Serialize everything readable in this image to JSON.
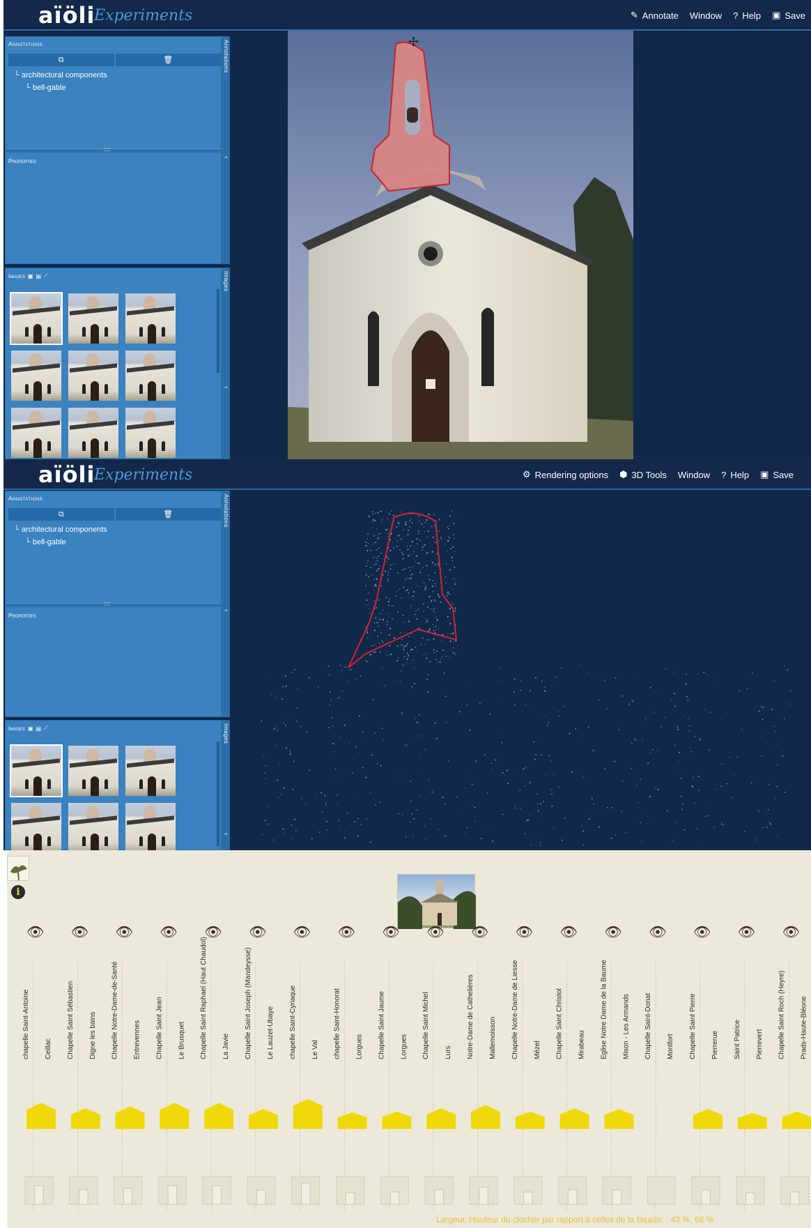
{
  "app_top": {
    "logo": "aïöli",
    "logo_sub": "Experiments",
    "menu": [
      {
        "icon": "pencil-icon",
        "glyph": "✎",
        "label": "Annotate"
      },
      {
        "icon": "",
        "glyph": "",
        "label": "Window"
      },
      {
        "icon": "help-icon",
        "glyph": "?",
        "label": "Help"
      },
      {
        "icon": "save-icon",
        "glyph": "▣",
        "label": "Save"
      }
    ],
    "annotations_title": "Annotations",
    "annotations_tab": "Annotations",
    "tree_parent": "architectural components",
    "tree_child": "bell-gable",
    "properties_title": "Properties",
    "images_title": "Images",
    "images_tab": "Images"
  },
  "app_bottom": {
    "logo": "aïöli",
    "logo_sub": "Experiments",
    "menu": [
      {
        "icon": "gears-icon",
        "glyph": "⚙",
        "label": "Rendering options"
      },
      {
        "icon": "cube-icon",
        "glyph": "⬢",
        "label": "3D Tools"
      },
      {
        "icon": "",
        "glyph": "",
        "label": "Window"
      },
      {
        "icon": "help-icon",
        "glyph": "?",
        "label": "Help"
      },
      {
        "icon": "save-icon",
        "glyph": "▣",
        "label": "Save"
      }
    ],
    "annotations_title": "Annotations",
    "annotations_tab": "Annotations",
    "tree_parent": "architectural components",
    "tree_child": "bell-gable",
    "properties_title": "Properties",
    "images_title": "Images",
    "images_tab": "Images"
  },
  "chart_data": {
    "type": "bar",
    "caption": "Largeur, Hauteur du clocher par rapport à celles de la façade: : 43 %, 68 %",
    "items": [
      {
        "name": "chapelle Saint-Antoine",
        "place": "Ceillac",
        "gable_w": 0.78,
        "gable_h": 0.78
      },
      {
        "name": "Chapelle Saint Sébastien",
        "place": "Digne les bains",
        "gable_w": 0.78,
        "gable_h": 0.62
      },
      {
        "name": "Chapelle Notre-Dame-de-Santé",
        "place": "Entrevennes",
        "gable_w": 0.78,
        "gable_h": 0.68
      },
      {
        "name": "Chapelle Saint Jean",
        "place": "Le Brusquet",
        "gable_w": 0.78,
        "gable_h": 0.78
      },
      {
        "name": "Chapelle Saint Raphael (Haut Chaudol)",
        "place": "La Javie",
        "gable_w": 0.78,
        "gable_h": 0.78
      },
      {
        "name": "Chapelle Saint Joseph (Mandeysse)",
        "place": "Le Lauzet-Ubaye",
        "gable_w": 0.78,
        "gable_h": 0.6
      },
      {
        "name": "chapelle Saint-Cyriaque",
        "place": "Le Val",
        "gable_w": 0.78,
        "gable_h": 0.9
      },
      {
        "name": "chapelle Saint-Honorat",
        "place": "Lorgues",
        "gable_w": 0.78,
        "gable_h": 0.5
      },
      {
        "name": "Chapelle Saint Jaume",
        "place": "Lorgues",
        "gable_w": 0.78,
        "gable_h": 0.52
      },
      {
        "name": "Chapelle Saint Michel",
        "place": "Lurs",
        "gable_w": 0.78,
        "gable_h": 0.62
      },
      {
        "name": "Notre-Dame de Cathelières",
        "place": "Mallemoisson",
        "gable_w": 0.78,
        "gable_h": 0.72
      },
      {
        "name": "Chapelle Notre-Dame de Liesse",
        "place": "Mézel",
        "gable_w": 0.78,
        "gable_h": 0.52
      },
      {
        "name": "Chapelle Saint Christol",
        "place": "Mirabeau",
        "gable_w": 0.78,
        "gable_h": 0.62
      },
      {
        "name": "Eglise Notre Dame de la Baume",
        "place": "Mison - Les Armands",
        "gable_w": 0.78,
        "gable_h": 0.6
      },
      {
        "name": "Chapelle Saint-Donat",
        "place": "Montfort",
        "gable_w": 0.0,
        "gable_h": 0.0
      },
      {
        "name": "Chapelle Saint Pierre",
        "place": "Pierrerue",
        "gable_w": 0.78,
        "gable_h": 0.6
      },
      {
        "name": "Saint Patrice",
        "place": "Pierrevert",
        "gable_w": 0.78,
        "gable_h": 0.48
      },
      {
        "name": "Chapelle Saint Roch (Heyre)",
        "place": "Prads-Haute-Bléone",
        "gable_w": 0.78,
        "gable_h": 0.52
      }
    ]
  }
}
